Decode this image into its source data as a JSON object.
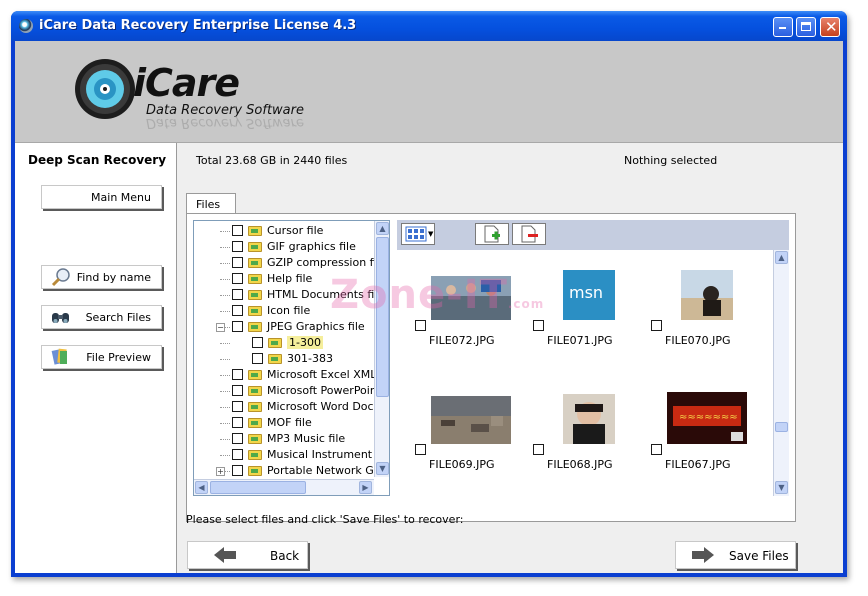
{
  "window": {
    "title": "iCare Data Recovery Enterprise License 4.3"
  },
  "banner": {
    "brand": "iCare",
    "tagline": "Data Recovery Software"
  },
  "sidebar": {
    "title": "Deep Scan Recovery",
    "buttons": [
      {
        "label": "Main Menu",
        "icon": "none"
      },
      {
        "label": "Find by name",
        "icon": "magnifier-icon"
      },
      {
        "label": "Search Files",
        "icon": "binoculars-icon"
      },
      {
        "label": "File Preview",
        "icon": "file-preview-icon"
      }
    ]
  },
  "status": {
    "total": "Total 23.68 GB in 2440 files",
    "selection": "Nothing selected"
  },
  "tabs": [
    "Files"
  ],
  "tree": {
    "items": [
      {
        "label": "Cursor file"
      },
      {
        "label": "GIF graphics file"
      },
      {
        "label": "GZIP compression file"
      },
      {
        "label": "Help file"
      },
      {
        "label": "HTML Documents file"
      },
      {
        "label": "Icon file"
      },
      {
        "label": "JPEG Graphics file",
        "expanded": true
      },
      {
        "label": "1-300",
        "child": true,
        "selected": true
      },
      {
        "label": "301-383",
        "child": true
      },
      {
        "label": "Microsoft Excel XML D"
      },
      {
        "label": "Microsoft PowerPoint"
      },
      {
        "label": "Microsoft Word Docum"
      },
      {
        "label": "MOF file"
      },
      {
        "label": "MP3 Music file"
      },
      {
        "label": "Musical Instrument Dig"
      },
      {
        "label": "Portable Network Grap",
        "collapsed": true
      }
    ]
  },
  "files": [
    {
      "name": "FILE072.JPG",
      "thumb": "crowd-photo"
    },
    {
      "name": "FILE071.JPG",
      "thumb": "msn-logo",
      "thumb_text": "msn"
    },
    {
      "name": "FILE070.JPG",
      "thumb": "beach-photo"
    },
    {
      "name": "FILE069.JPG",
      "thumb": "rubble-photo"
    },
    {
      "name": "FILE068.JPG",
      "thumb": "portrait-photo"
    },
    {
      "name": "FILE067.JPG",
      "thumb": "poster-photo"
    }
  ],
  "hint": "Please select files and click 'Save Files' to recover:",
  "nav": {
    "back_label": "Back",
    "save_label": "Save Files"
  },
  "watermark": {
    "text": "Zone-IT",
    "suffix": ".com"
  },
  "colors": {
    "titlebar": "#0550de",
    "banner": "#c8c8c8",
    "grid_toolbar": "#c5cde0"
  }
}
